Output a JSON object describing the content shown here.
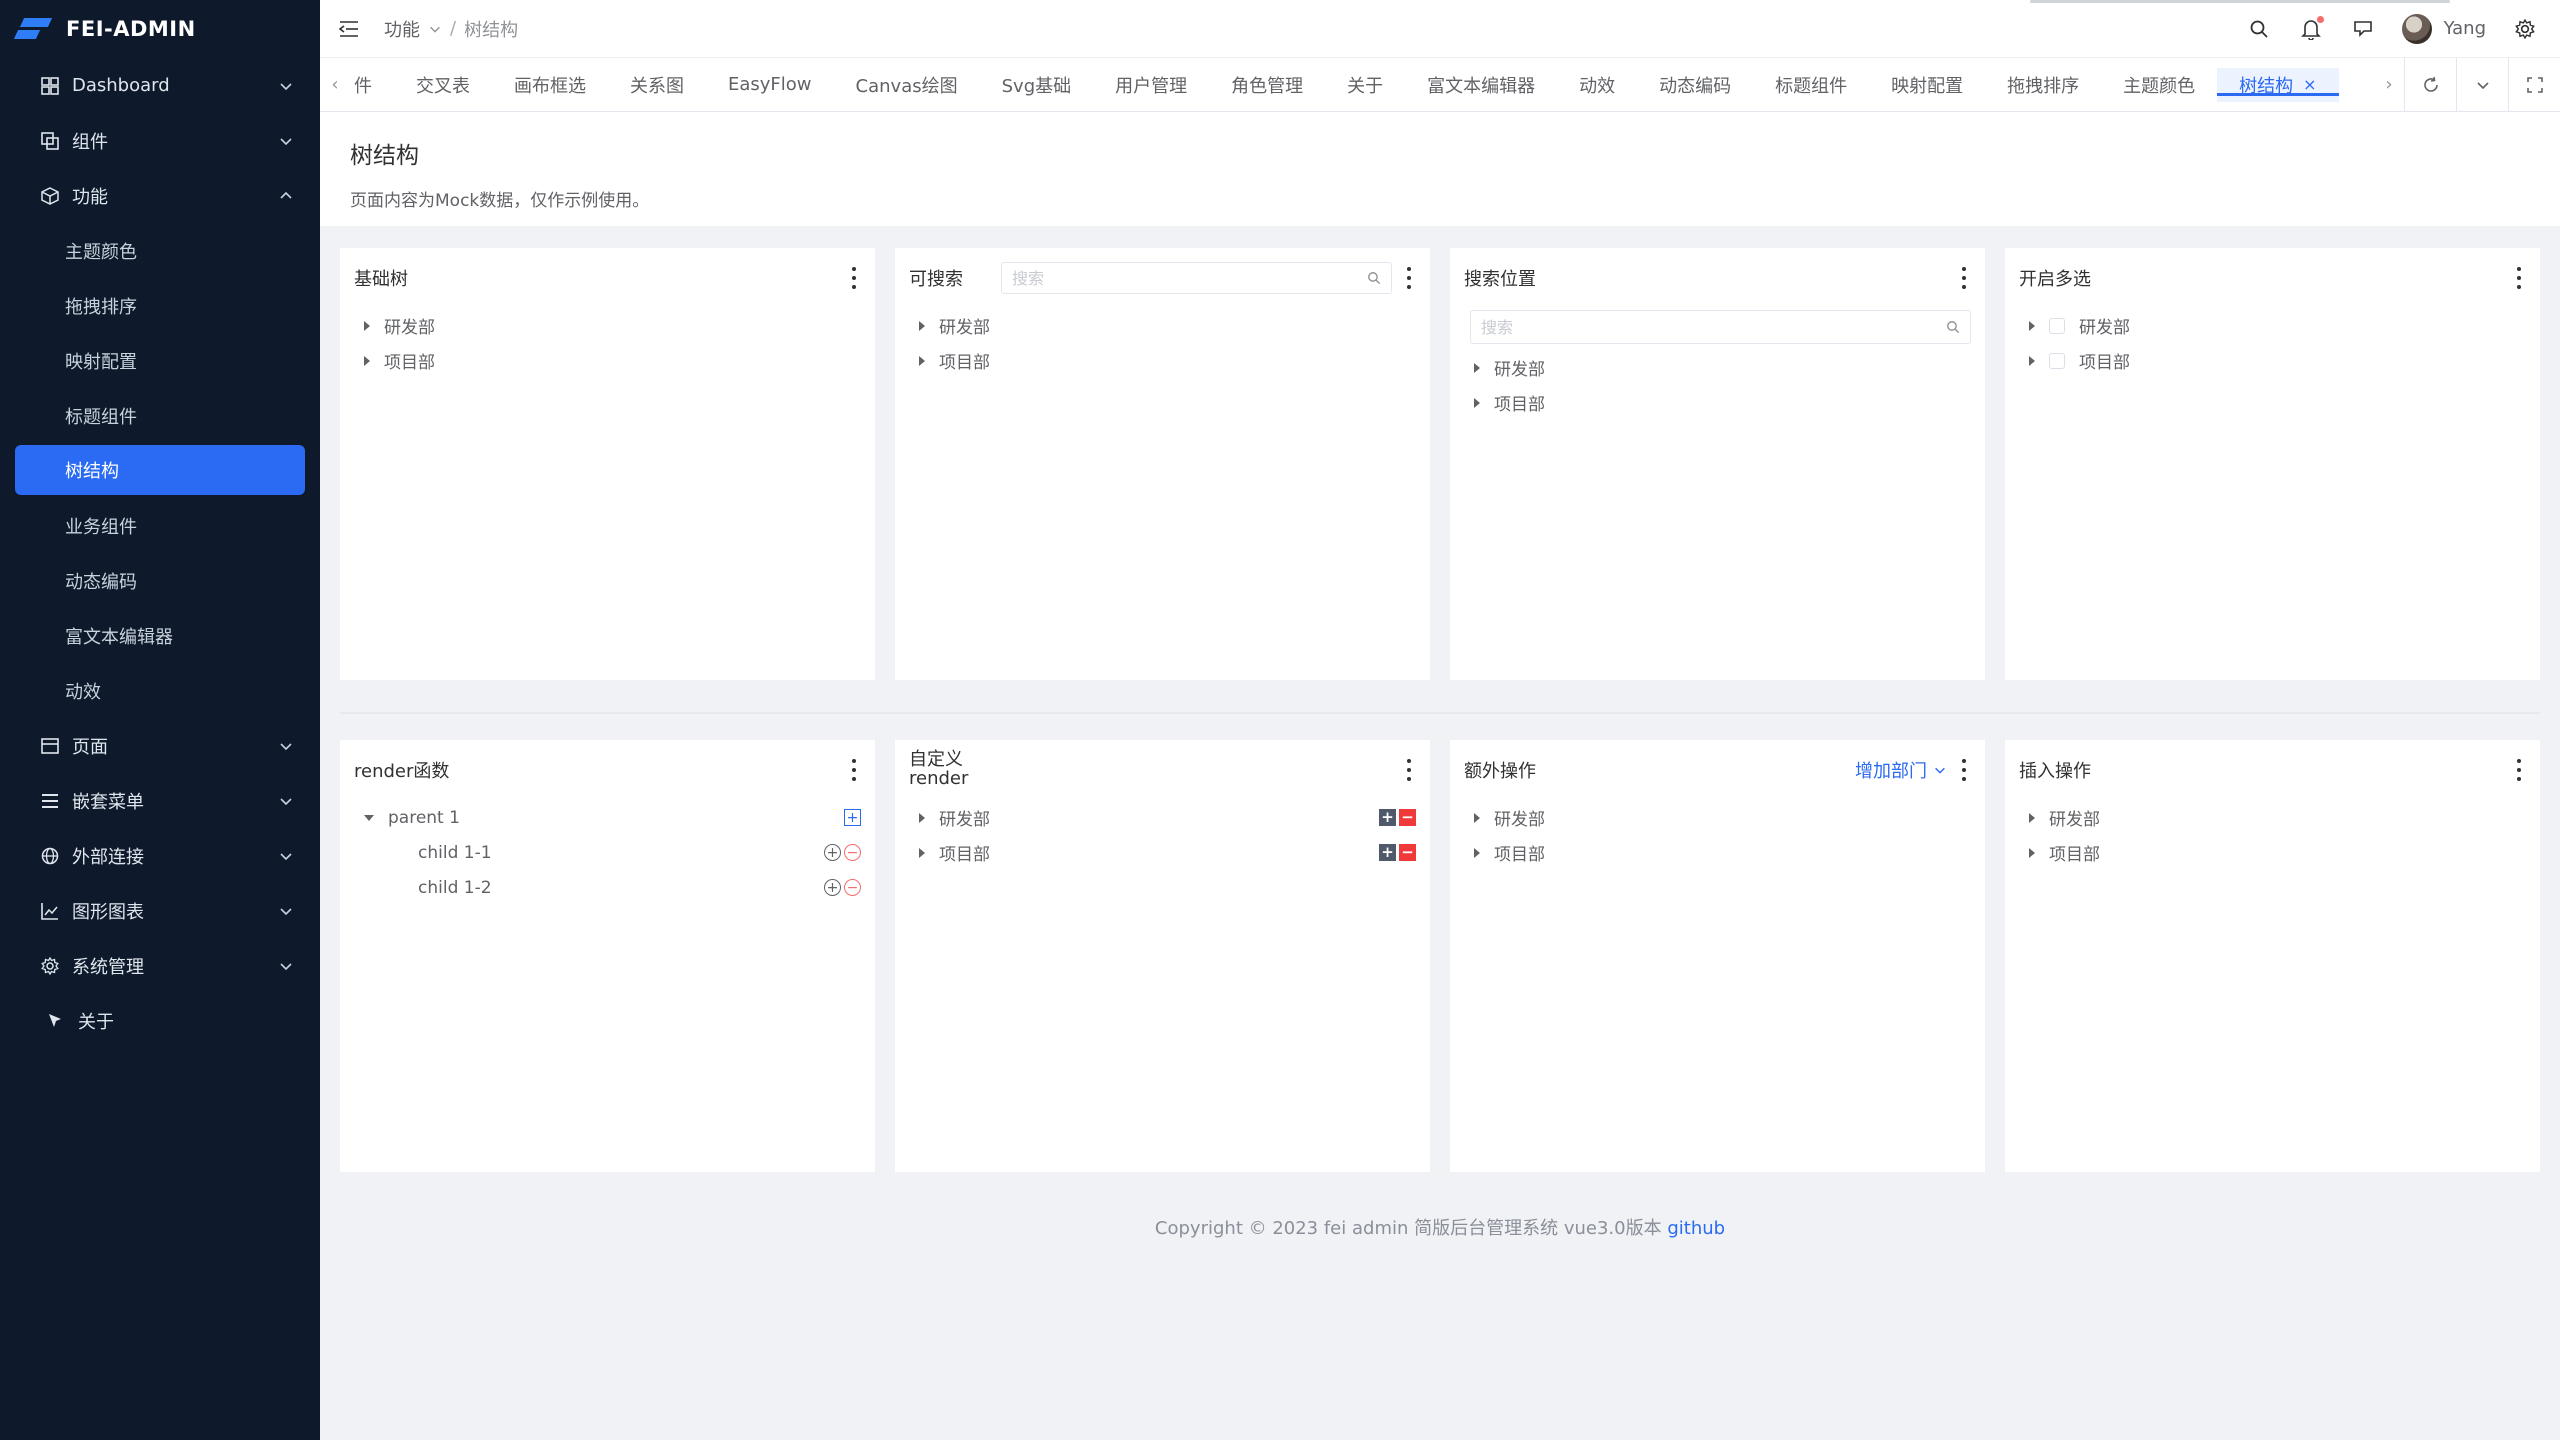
{
  "app": {
    "name": "FEI-ADMIN"
  },
  "sidebar": {
    "items": [
      {
        "label": "Dashboard",
        "icon": "grid-icon"
      },
      {
        "label": "组件",
        "icon": "copy-icon"
      },
      {
        "label": "功能",
        "icon": "cube-icon",
        "expanded": true
      },
      {
        "label": "页面",
        "icon": "window-icon"
      },
      {
        "label": "嵌套菜单",
        "icon": "menu-icon"
      },
      {
        "label": "外部连接",
        "icon": "globe-icon"
      },
      {
        "label": "图形图表",
        "icon": "chart-icon"
      },
      {
        "label": "系统管理",
        "icon": "gear-icon"
      },
      {
        "label": "关于",
        "icon": "pointer-icon"
      }
    ],
    "sub_items": [
      "主题颜色",
      "拖拽排序",
      "映射配置",
      "标题组件",
      "树结构",
      "业务组件",
      "动态编码",
      "富文本编辑器",
      "动效"
    ],
    "active_sub": "树结构"
  },
  "header": {
    "breadcrumb": [
      "功能",
      "树结构"
    ],
    "user_name": "Yang"
  },
  "tabs": {
    "items": [
      "件",
      "交叉表",
      "画布框选",
      "关系图",
      "EasyFlow",
      "Canvas绘图",
      "Svg基础",
      "用户管理",
      "角色管理",
      "关于",
      "富文本编辑器",
      "动效",
      "动态编码",
      "标题组件",
      "映射配置",
      "拖拽排序",
      "主题颜色",
      "树结构"
    ],
    "active": "树结构",
    "close_glyph": "×"
  },
  "page": {
    "title": "树结构",
    "description": "页面内容为Mock数据，仅作示例使用。"
  },
  "cards": {
    "basic": {
      "title": "基础树",
      "nodes": [
        "研发部",
        "项目部"
      ]
    },
    "searchable": {
      "title": "可搜索",
      "placeholder": "搜索",
      "nodes": [
        "研发部",
        "项目部"
      ]
    },
    "search_position": {
      "title": "搜索位置",
      "placeholder": "搜索",
      "nodes": [
        "研发部",
        "项目部"
      ]
    },
    "multi": {
      "title": "开启多选",
      "nodes": [
        "研发部",
        "项目部"
      ]
    },
    "render_fn": {
      "title": "render函数",
      "parent": "parent 1",
      "children": [
        "child 1-1",
        "child 1-2"
      ]
    },
    "custom_render": {
      "title_line1": "自定义",
      "title_line2": "render",
      "nodes": [
        "研发部",
        "项目部"
      ]
    },
    "extra_ops": {
      "title": "额外操作",
      "action": "增加部门",
      "nodes": [
        "研发部",
        "项目部"
      ]
    },
    "insert_ops": {
      "title": "插入操作",
      "nodes": [
        "研发部",
        "项目部"
      ]
    }
  },
  "footer": {
    "text": "Copyright © 2023 fei admin 简版后台管理系统 vue3.0版本",
    "link": "github"
  },
  "colors": {
    "sidebar_bg": "#0e1a2b",
    "primary": "#2b6af2",
    "danger": "#f03a3a"
  }
}
